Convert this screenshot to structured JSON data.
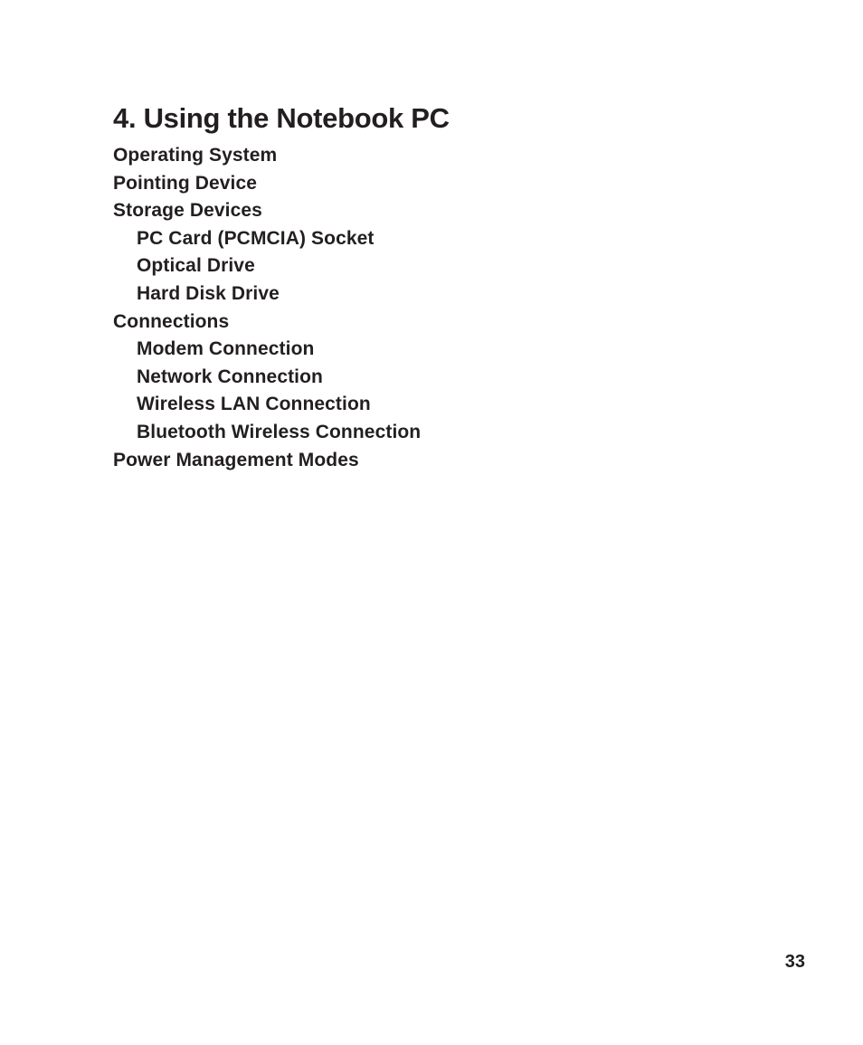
{
  "page": {
    "title": "4. Using the Notebook PC",
    "page_number": "33"
  },
  "toc": {
    "items": [
      {
        "label": "Operating System",
        "level": 1
      },
      {
        "label": "Pointing Device",
        "level": 1
      },
      {
        "label": "Storage Devices",
        "level": 1
      },
      {
        "label": "PC Card (PCMCIA) Socket",
        "level": 2
      },
      {
        "label": "Optical Drive",
        "level": 2
      },
      {
        "label": "Hard Disk Drive",
        "level": 2
      },
      {
        "label": "Connections",
        "level": 1
      },
      {
        "label": "Modem Connection",
        "level": 2
      },
      {
        "label": "Network Connection",
        "level": 2
      },
      {
        "label": "Wireless LAN Connection",
        "level": 2
      },
      {
        "label": "Bluetooth Wireless Connection",
        "level": 2
      },
      {
        "label": "Power Management Modes",
        "level": 1
      }
    ]
  },
  "colors": {
    "text": "#231f20",
    "background": "#ffffff"
  }
}
